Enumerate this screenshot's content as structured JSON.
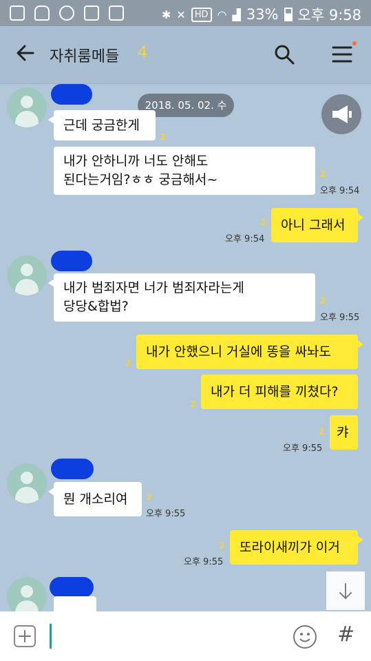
{
  "status_bar": {
    "hd": "HD",
    "battery": "33%",
    "time": "오후 9:58"
  },
  "header": {
    "title": "자취룸메들",
    "member_count": "4"
  },
  "date_divider": "2018. 05. 02. 수",
  "messages": [
    {
      "side": "left",
      "text": "근데 궁금한게",
      "unread": "2",
      "time": ""
    },
    {
      "side": "left",
      "text": "내가 안하니까 너도 안해도\n된다는거임?ㅎㅎ 궁금해서~",
      "unread": "2",
      "time": "오후 9:54"
    },
    {
      "side": "right",
      "text": "아니 그래서",
      "unread": "2",
      "time": "오후 9:54"
    },
    {
      "side": "left",
      "text": "내가 범죄자면 너가 범죄자라는게\n당당&합법?",
      "unread": "2",
      "time": "오후 9:55"
    },
    {
      "side": "right",
      "text": "내가 안했으니 거실에 똥을 싸놔도",
      "unread": "2",
      "time": ""
    },
    {
      "side": "right",
      "text": "내가 더 피해를 끼쳤다?",
      "unread": "2",
      "time": ""
    },
    {
      "side": "right",
      "text": "캬",
      "unread": "2",
      "time": "오후 9:55"
    },
    {
      "side": "left",
      "text": "뭔 개소리여",
      "unread": "2",
      "time": "오후 9:55"
    },
    {
      "side": "right",
      "text": "또라이새끼가 이거",
      "unread": "2",
      "time": "오후 9:55"
    }
  ],
  "colors": {
    "chat_bg": "#b2c7d9",
    "my_bubble": "#ffeb33",
    "their_bubble": "#ffffff",
    "unread": "#f0d23a"
  },
  "icons": [
    "back-arrow-icon",
    "search-icon",
    "menu-icon",
    "megaphone-icon",
    "scroll-down-icon",
    "plus-icon",
    "emoji-icon",
    "hash-icon"
  ]
}
